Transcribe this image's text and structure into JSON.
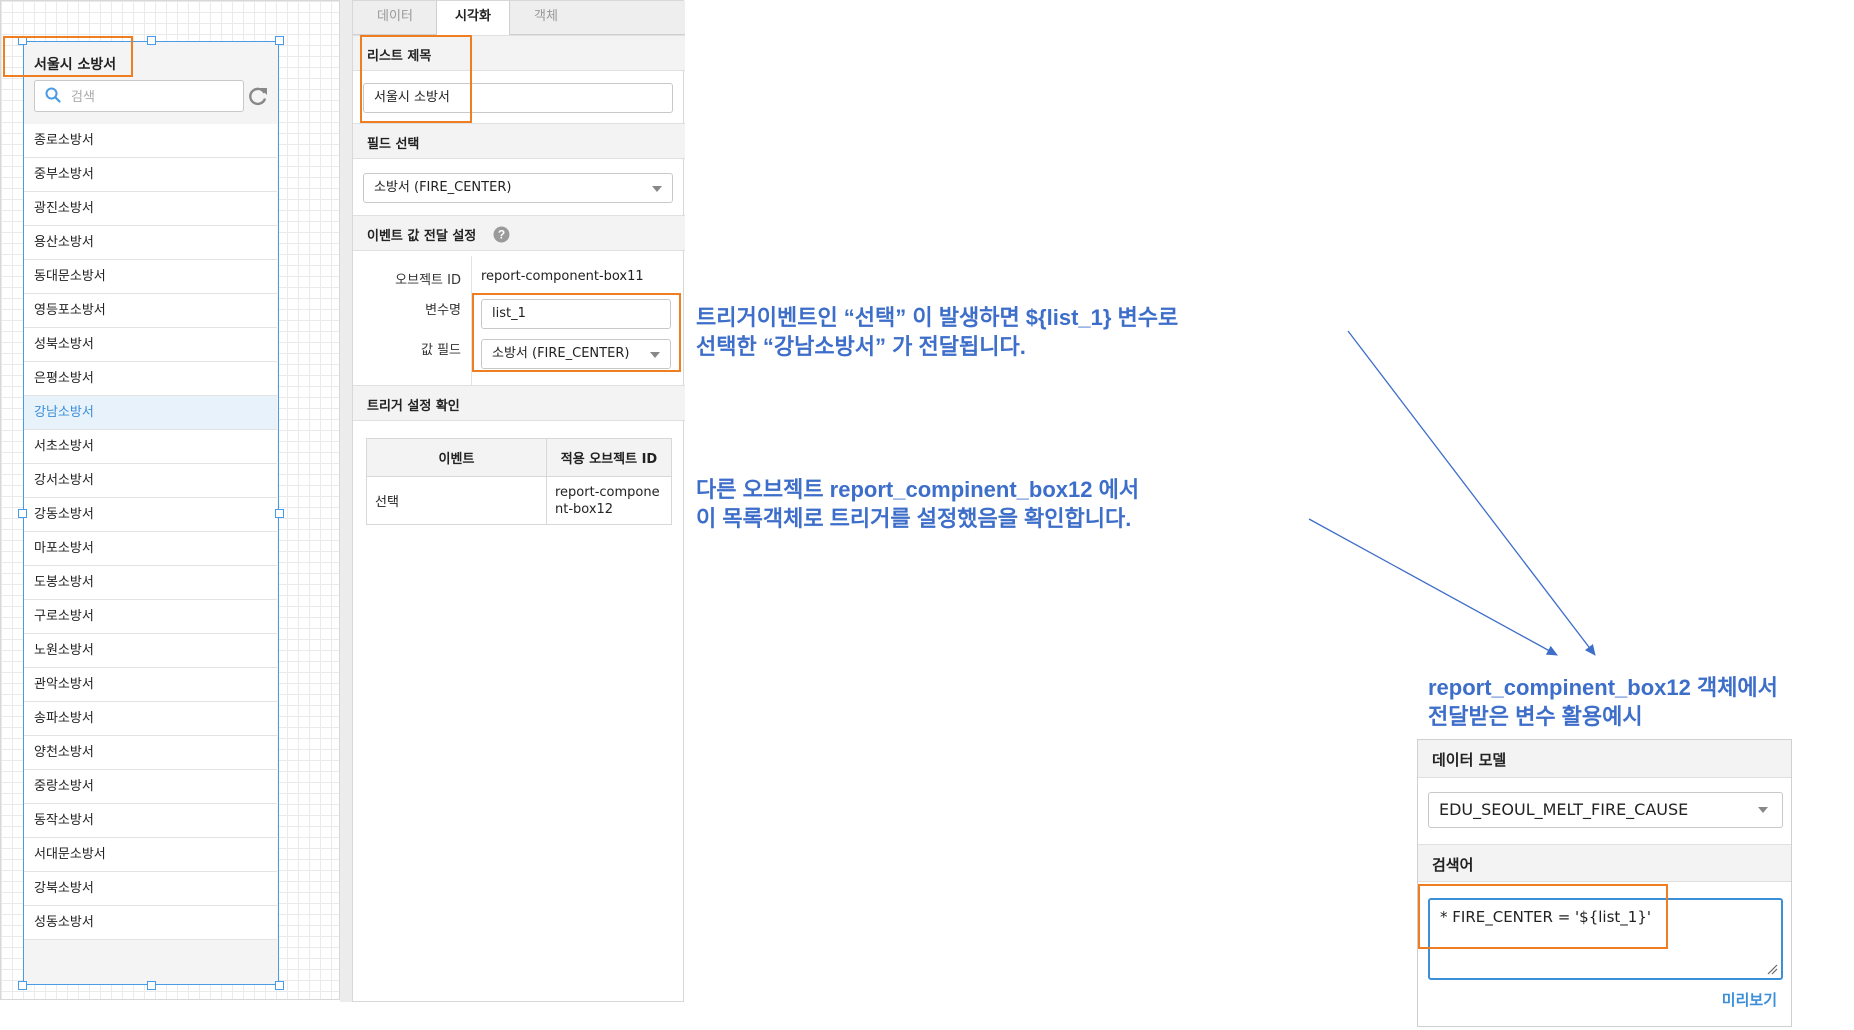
{
  "canvas": {
    "list_title": "서울시 소방서",
    "search_placeholder": "검색",
    "items": [
      "종로소방서",
      "중부소방서",
      "광진소방서",
      "용산소방서",
      "동대문소방서",
      "영등포소방서",
      "성북소방서",
      "은평소방서",
      "강남소방서",
      "서초소방서",
      "강서소방서",
      "강동소방서",
      "마포소방서",
      "도봉소방서",
      "구로소방서",
      "노원소방서",
      "관악소방서",
      "송파소방서",
      "양천소방서",
      "중랑소방서",
      "동작소방서",
      "서대문소방서",
      "강북소방서",
      "성동소방서"
    ],
    "selected_item": "강남소방서"
  },
  "panel": {
    "tabs": [
      {
        "label": "데이터",
        "active": false
      },
      {
        "label": "시각화",
        "active": true
      },
      {
        "label": "객체",
        "active": false
      }
    ],
    "list_title_header": "리스트 제목",
    "list_title_value": "서울시 소방서",
    "field_select_header": "필드 선택",
    "field_select_value": "소방서 (FIRE_CENTER)",
    "event_header": "이벤트 값 전달 설정",
    "object_id_label": "오브젝트 ID",
    "object_id_value": "report-component-box11",
    "var_name_label": "변수명",
    "var_name_value": "list_1",
    "value_field_label": "값 필드",
    "value_field_value": "소방서 (FIRE_CENTER)",
    "trigger_header": "트리거 설정 확인",
    "trigger_table": {
      "headers": [
        "이벤트",
        "적용 오브젝트 ID"
      ],
      "rows": [
        [
          "선택",
          "report-component-box12"
        ]
      ]
    }
  },
  "annotations": {
    "note1_line1": "트리거이벤트인 “선택” 이 발생하면 ${list_1} 변수로",
    "note1_line2": "선택한 “강남소방서” 가 전달됩니다.",
    "note2_line1": "다른 오브젝트 report_compinent_box12 에서",
    "note2_line2": "이 목록객체로 트리거를 설정했음을 확인합니다.",
    "note3_line1": "report_compinent_box12 객체에서",
    "note3_line2": "전달받은 변수 활용예시"
  },
  "mini_panel": {
    "data_model_header": "데이터 모델",
    "data_model_value": "EDU_SEOUL_MELT_FIRE_CAUSE",
    "search_header": "검색어",
    "search_value": "*  FIRE_CENTER = '${list_1}'",
    "preview_label": "미리보기"
  },
  "colors": {
    "accent_blue": "#3d6ec9",
    "highlight_orange": "#ef7d22",
    "selection_blue": "#4a9be6"
  }
}
